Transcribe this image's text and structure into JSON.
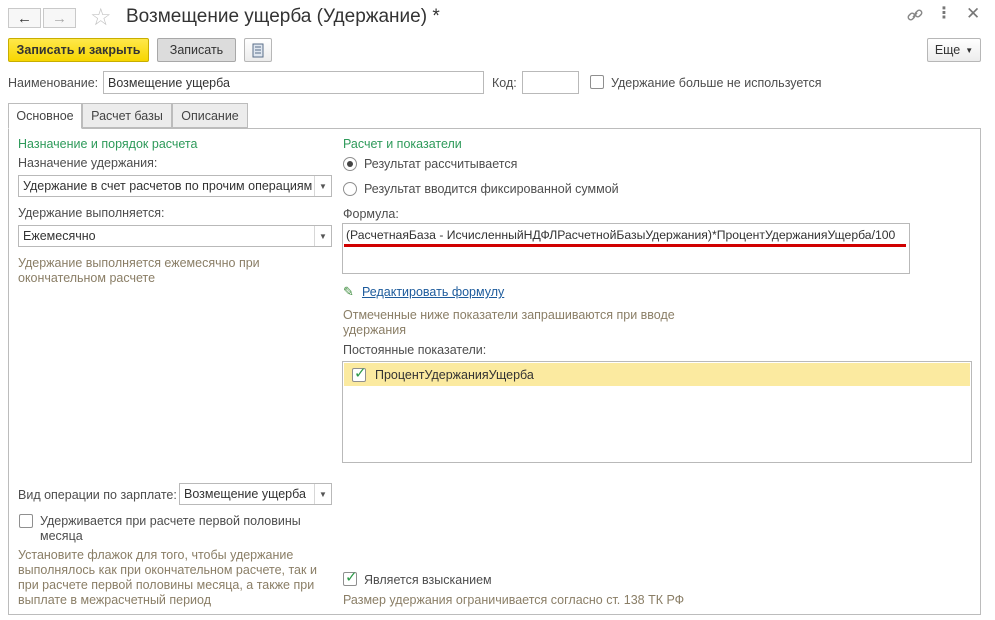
{
  "window": {
    "title": "Возмещение ущерба (Удержание) *"
  },
  "icons": {
    "back": "arrow-left-icon",
    "forward": "arrow-right-icon",
    "favorite": "star-icon",
    "link": "link-icon",
    "more": "more-vertical-icon",
    "close": "close-icon",
    "report": "document-icon",
    "edit": "pencil-icon"
  },
  "toolbar": {
    "save_close_label": "Записать и закрыть",
    "save_label": "Записать",
    "more_label": "Еще"
  },
  "header_fields": {
    "name_label": "Наименование:",
    "name_value": "Возмещение ущерба",
    "code_label": "Код:",
    "code_value": "",
    "unused_label": "Удержание больше не используется"
  },
  "tabs": [
    {
      "label": "Основное",
      "active": true
    },
    {
      "label": "Расчет базы",
      "active": false
    },
    {
      "label": "Описание",
      "active": false
    }
  ],
  "left": {
    "section_title": "Назначение и порядок расчета",
    "purpose_label": "Назначение удержания:",
    "purpose_value": "Удержание в счет расчетов по прочим операциям",
    "frequency_label": "Удержание выполняется:",
    "frequency_value": "Ежемесячно",
    "frequency_hint": "Удержание выполняется ежемесячно при окончательном расчете",
    "operation_label": "Вид операции по зарплате:",
    "operation_value": "Возмещение ущерба",
    "first_half_label": "Удерживается при расчете первой половины месяца",
    "first_half_hint": "Установите флажок для того, чтобы удержание выполнялось как при окончательном расчете, так и при расчете первой половины месяца, а также при выплате в межрасчетный период"
  },
  "right": {
    "section_title": "Расчет и показатели",
    "radio_calculated": "Результат рассчитывается",
    "radio_fixed": "Результат вводится фиксированной суммой",
    "formula_label": "Формула:",
    "formula_value": "(РасчетнаяБаза - ИсчисленныйНДФЛРасчетнойБазыУдержания)*ПроцентУдержанияУщерба/100",
    "edit_formula_link": "Редактировать формулу",
    "indicators_hint": "Отмеченные ниже показатели запрашиваются при вводе удержания",
    "constant_indicators_label": "Постоянные показатели:",
    "indicators": [
      {
        "name": "ПроцентУдержанияУщерба",
        "checked": true
      }
    ],
    "penalty_label": "Является взысканием",
    "penalty_hint": "Размер удержания ограничивается согласно ст. 138 ТК РФ"
  },
  "colors": {
    "accent_yellow": "#f7d600",
    "section_green": "#2e9a5a",
    "hint_brown": "#8a7e66",
    "selected_row": "#fbeaa0",
    "underline_red": "#d00000"
  }
}
